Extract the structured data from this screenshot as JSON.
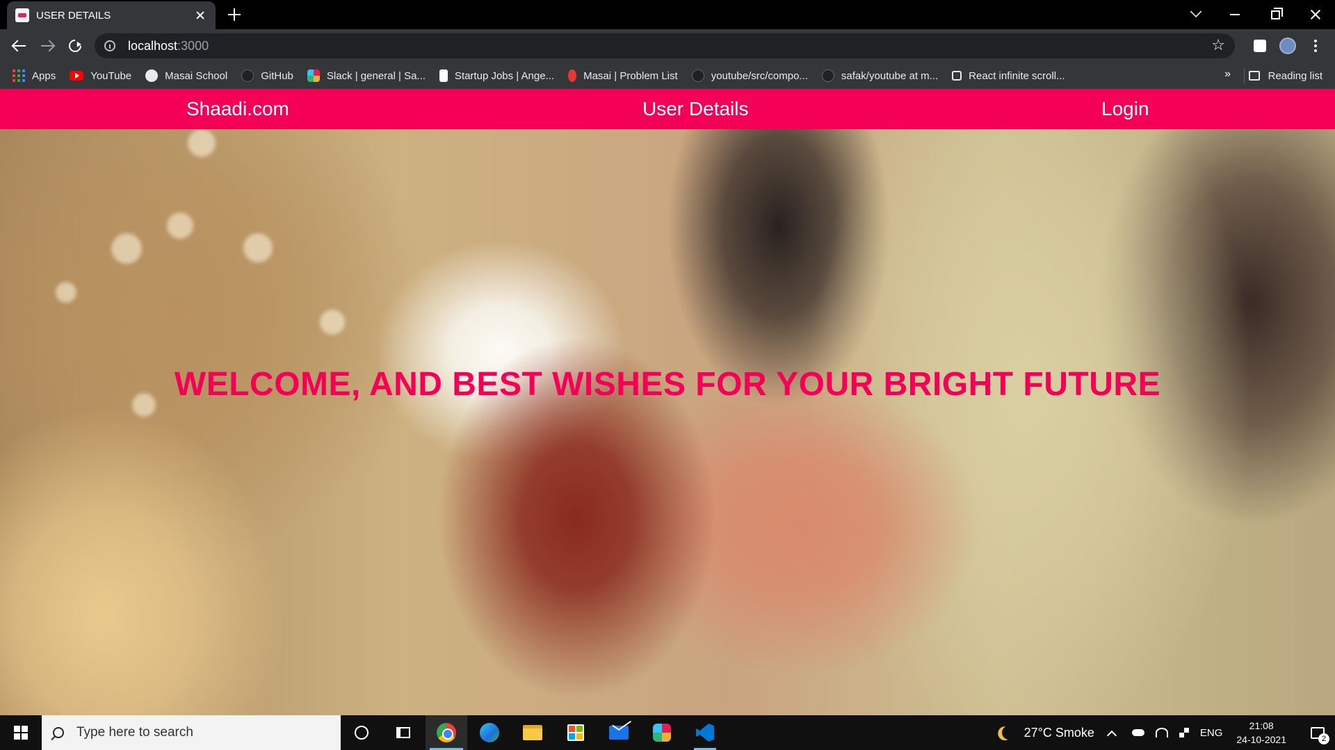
{
  "browser": {
    "tab_title": "USER DETAILS",
    "url_host": "localhost",
    "url_port": ":3000",
    "bookmarks": [
      {
        "label": "Apps",
        "icon": "apps-grid-icon"
      },
      {
        "label": "YouTube",
        "icon": "youtube-icon"
      },
      {
        "label": "Masai School",
        "icon": "masai-school-icon"
      },
      {
        "label": "GitHub",
        "icon": "github-icon"
      },
      {
        "label": "Slack | general | Sa...",
        "icon": "slack-icon"
      },
      {
        "label": "Startup Jobs | Ange...",
        "icon": "angellist-icon"
      },
      {
        "label": "Masai | Problem List",
        "icon": "masai-icon"
      },
      {
        "label": "youtube/src/compo...",
        "icon": "github-icon"
      },
      {
        "label": "safak/youtube at m...",
        "icon": "github-icon"
      },
      {
        "label": "React infinite scroll...",
        "icon": "codesandbox-icon"
      }
    ],
    "more_bookmarks": "»",
    "reading_list": "Reading list"
  },
  "site": {
    "nav": {
      "brand": "Shaadi.com",
      "title": "User Details",
      "login": "Login"
    },
    "hero_text": "WELCOME, AND BEST WISHES FOR YOUR BRIGHT FUTURE",
    "colors": {
      "accent": "#f50057"
    }
  },
  "taskbar": {
    "search_placeholder": "Type here to search",
    "weather": "27°C  Smoke",
    "language": "ENG",
    "time": "21:08",
    "date": "24-10-2021",
    "notification_count": "2"
  }
}
